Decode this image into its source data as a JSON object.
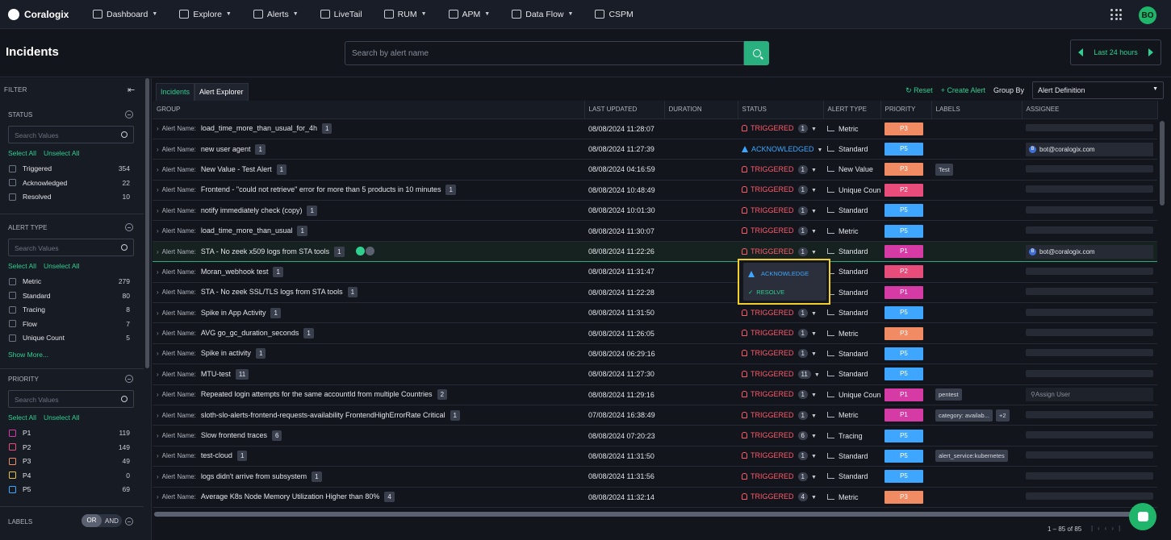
{
  "nav": {
    "brand": "Coralogix",
    "items": [
      {
        "label": "Dashboard",
        "icon": "dashboard-icon",
        "caret": true
      },
      {
        "label": "Explore",
        "icon": "explore-icon",
        "caret": true
      },
      {
        "label": "Alerts",
        "icon": "bell-icon",
        "caret": true
      },
      {
        "label": "LiveTail",
        "icon": "terminal-icon",
        "caret": false
      },
      {
        "label": "RUM",
        "icon": "rum-icon",
        "caret": true
      },
      {
        "label": "APM",
        "icon": "gauge-icon",
        "caret": true
      },
      {
        "label": "Data Flow",
        "icon": "dataflow-icon",
        "caret": true
      },
      {
        "label": "CSPM",
        "icon": "shield-icon",
        "caret": false
      }
    ],
    "avatar": "BO"
  },
  "header": {
    "title": "Incidents",
    "search_placeholder": "Search by alert name",
    "timerange": "Last 24 hours"
  },
  "sidebar": {
    "filter_label": "FILTER",
    "select_all": "Select All",
    "unselect_all": "Unselect All",
    "search_placeholder": "Search Values",
    "status": {
      "title": "STATUS",
      "options": [
        {
          "label": "Triggered",
          "count": "354"
        },
        {
          "label": "Acknowledged",
          "count": "22"
        },
        {
          "label": "Resolved",
          "count": "10"
        }
      ]
    },
    "alert_type": {
      "title": "ALERT TYPE",
      "options": [
        {
          "label": "Metric",
          "count": "279"
        },
        {
          "label": "Standard",
          "count": "80"
        },
        {
          "label": "Tracing",
          "count": "8"
        },
        {
          "label": "Flow",
          "count": "7"
        },
        {
          "label": "Unique Count",
          "count": "5"
        }
      ],
      "show_more": "Show More..."
    },
    "priority": {
      "title": "PRIORITY",
      "options": [
        {
          "label": "P1",
          "count": "119",
          "color": "#d63aa4"
        },
        {
          "label": "P2",
          "count": "149",
          "color": "#e84c7a"
        },
        {
          "label": "P3",
          "count": "49",
          "color": "#f08b63"
        },
        {
          "label": "P4",
          "count": "0",
          "color": "#e8c343"
        },
        {
          "label": "P5",
          "count": "69",
          "color": "#3fa6ff"
        }
      ]
    },
    "labels": {
      "title": "LABELS",
      "or": "OR",
      "and": "AND"
    }
  },
  "toolbar": {
    "tabs": [
      "Incidents",
      "Alert Explorer"
    ],
    "reset": "Reset",
    "create_alert": "Create Alert",
    "group_by_label": "Group By",
    "group_by_value": "Alert Definition"
  },
  "table": {
    "columns": [
      "GROUP",
      "LAST UPDATED",
      "DURATION",
      "STATUS",
      "ALERT TYPE",
      "PRIORITY",
      "LABELS",
      "ASSIGNEE"
    ],
    "alert_name_prefix": "Alert Name:",
    "rows": [
      {
        "name": "load_time_more_than_usual_for_4h",
        "count": "1",
        "updated": "08/08/2024 11:28:07",
        "status": "TRIGGERED",
        "scount": "1",
        "type": "Metric",
        "priority": "P3",
        "labels": [],
        "assignee": ""
      },
      {
        "name": "new user agent",
        "count": "1",
        "updated": "08/08/2024 11:27:39",
        "status": "ACKNOWLEDGED",
        "scount": "",
        "type": "Standard",
        "priority": "P5",
        "labels": [],
        "assignee": "bot@coralogix.com"
      },
      {
        "name": "New Value - Test Alert",
        "count": "1",
        "updated": "08/08/2024 04:16:59",
        "status": "TRIGGERED",
        "scount": "1",
        "type": "New Value",
        "priority": "P3",
        "labels": [
          "Test"
        ],
        "assignee": ""
      },
      {
        "name": "Frontend - \"could not retrieve\" error for more than 5 products in 10 minutes",
        "count": "1",
        "updated": "08/08/2024 10:48:49",
        "status": "TRIGGERED",
        "scount": "1",
        "type": "Unique Count",
        "priority": "P2",
        "labels": [],
        "assignee": ""
      },
      {
        "name": "notify immediately check (copy)",
        "count": "1",
        "updated": "08/08/2024 10:01:30",
        "status": "TRIGGERED",
        "scount": "1",
        "type": "Standard",
        "priority": "P5",
        "labels": [],
        "assignee": ""
      },
      {
        "name": "load_time_more_than_usual",
        "count": "1",
        "updated": "08/08/2024 11:30:07",
        "status": "TRIGGERED",
        "scount": "1",
        "type": "Metric",
        "priority": "P5",
        "labels": [],
        "assignee": ""
      },
      {
        "name": "STA - No zeek x509 logs from STA tools",
        "count": "1",
        "updated": "08/08/2024 11:22:26",
        "status": "TRIGGERED",
        "scount": "1",
        "type": "Standard",
        "priority": "P1",
        "labels": [],
        "assignee": "bot@coralogix.com",
        "highlight": true
      },
      {
        "name": "Moran_webhook test",
        "count": "1",
        "updated": "08/08/2024 11:31:47",
        "status": "",
        "scount": "",
        "type": "Standard",
        "priority": "P2",
        "labels": [],
        "assignee": ""
      },
      {
        "name": "STA - No zeek SSL/TLS logs from STA tools",
        "count": "1",
        "updated": "08/08/2024 11:22:28",
        "status": "",
        "scount": "",
        "type": "Standard",
        "priority": "P1",
        "labels": [],
        "assignee": ""
      },
      {
        "name": "Spike in App Activity",
        "count": "1",
        "updated": "08/08/2024 11:31:50",
        "status": "TRIGGERED",
        "scount": "1",
        "type": "Standard",
        "priority": "P5",
        "labels": [],
        "assignee": ""
      },
      {
        "name": "AVG go_gc_duration_seconds",
        "count": "1",
        "updated": "08/08/2024 11:26:05",
        "status": "TRIGGERED",
        "scount": "1",
        "type": "Metric",
        "priority": "P3",
        "labels": [],
        "assignee": ""
      },
      {
        "name": "Spike in activity",
        "count": "1",
        "updated": "08/08/2024 06:29:16",
        "status": "TRIGGERED",
        "scount": "1",
        "type": "Standard",
        "priority": "P5",
        "labels": [],
        "assignee": ""
      },
      {
        "name": "MTU-test",
        "count": "11",
        "updated": "08/08/2024 11:27:30",
        "status": "TRIGGERED",
        "scount": "11",
        "type": "Standard",
        "priority": "P5",
        "labels": [],
        "assignee": ""
      },
      {
        "name": "Repeated login attempts for the same accountId from multiple Countries",
        "count": "2",
        "updated": "08/08/2024 11:29:16",
        "status": "TRIGGERED",
        "scount": "1",
        "type": "Unique Count",
        "priority": "P1",
        "labels": [
          "pentest"
        ],
        "assignee": "Assign User"
      },
      {
        "name": "sloth-slo-alerts-frontend-requests-availability FrontendHighErrorRate Critical",
        "count": "1",
        "updated": "07/08/2024 16:38:49",
        "status": "TRIGGERED",
        "scount": "1",
        "type": "Metric",
        "priority": "P1",
        "labels": [
          "category: availab...",
          "+2"
        ],
        "assignee": ""
      },
      {
        "name": "Slow frontend traces",
        "count": "6",
        "updated": "08/08/2024 07:20:23",
        "status": "TRIGGERED",
        "scount": "6",
        "type": "Tracing",
        "priority": "P5",
        "labels": [],
        "assignee": ""
      },
      {
        "name": "test-cloud",
        "count": "1",
        "updated": "08/08/2024 11:31:50",
        "status": "TRIGGERED",
        "scount": "1",
        "type": "Standard",
        "priority": "P5",
        "labels": [
          "alert_service:kubernetes"
        ],
        "assignee": ""
      },
      {
        "name": "logs didn't arrive from subsystem",
        "count": "1",
        "updated": "08/08/2024 11:31:56",
        "status": "TRIGGERED",
        "scount": "1",
        "type": "Standard",
        "priority": "P5",
        "labels": [],
        "assignee": ""
      },
      {
        "name": "Average K8s Node Memory Utilization Higher than 80%",
        "count": "4",
        "updated": "08/08/2024 11:32:14",
        "status": "TRIGGERED",
        "scount": "4",
        "type": "Metric",
        "priority": "P3",
        "labels": [],
        "assignee": ""
      }
    ]
  },
  "priority_colors": {
    "P1": "#d63aa4",
    "P2": "#e84c7a",
    "P3": "#f08b63",
    "P5": "#3fa6ff"
  },
  "popup": {
    "acknowledge": "ACKNOWLEDGE",
    "resolve": "RESOLVE"
  },
  "footer": {
    "range": "1 – 85 of 85"
  }
}
